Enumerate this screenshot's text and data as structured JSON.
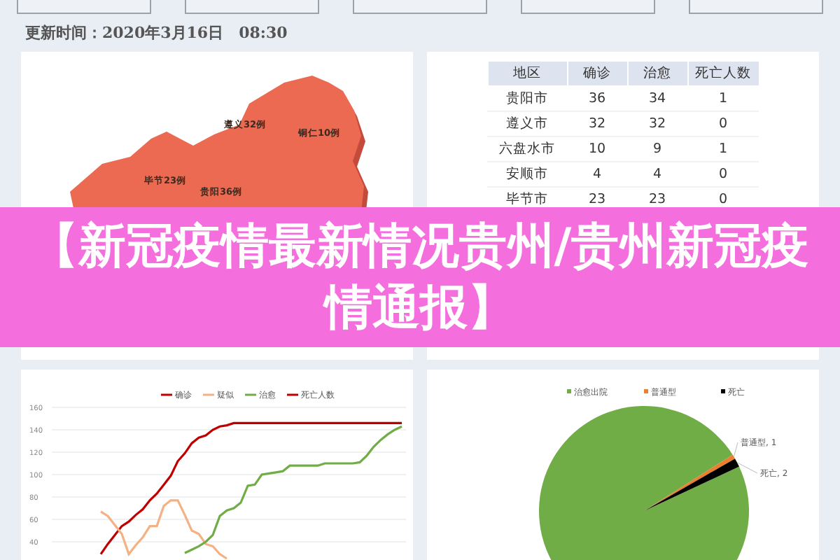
{
  "update_time": "更新时间：2020年3月16日　08:30",
  "map": {
    "labels": [
      "遵义32例",
      "铜仁10例",
      "毕节23例",
      "贵阳36例"
    ]
  },
  "table": {
    "columns": [
      "地区",
      "确诊",
      "治愈",
      "死亡人数"
    ],
    "rows": [
      {
        "cells": [
          "贵阳市",
          "36",
          "34",
          "1"
        ]
      },
      {
        "cells": [
          "遵义市",
          "32",
          "32",
          "0"
        ]
      },
      {
        "cells": [
          "六盘水市",
          "10",
          "9",
          "1"
        ]
      },
      {
        "cells": [
          "安顺市",
          "4",
          "4",
          "0"
        ]
      },
      {
        "cells": [
          "毕节市",
          "23",
          "23",
          "0"
        ]
      }
    ]
  },
  "line_chart": {
    "chart_data": {
      "type": "line",
      "ylim": [
        20,
        160
      ],
      "yticks": [
        40,
        60,
        80,
        100,
        120,
        140,
        160
      ],
      "grid": true,
      "legend": "top",
      "series": [
        {
          "name": "确诊",
          "color": "#c00000",
          "values": [
            29,
            38,
            46,
            54,
            58,
            64,
            69,
            77,
            83,
            91,
            99,
            112,
            119,
            128,
            133,
            135,
            140,
            143,
            144,
            146,
            146,
            146,
            146,
            146,
            146,
            146,
            146,
            146,
            146,
            146,
            146,
            146,
            146,
            146,
            146,
            146,
            146,
            146,
            146,
            146,
            146,
            146,
            146,
            146
          ]
        },
        {
          "name": "疑似",
          "color": "#f4b183",
          "values": [
            67,
            63,
            55,
            47,
            29,
            37,
            44,
            54,
            54,
            72,
            77,
            77,
            64,
            50,
            47,
            38,
            36,
            29,
            25,
            null,
            null,
            null,
            null,
            null,
            null,
            null,
            null,
            null,
            null,
            null,
            null,
            null,
            null,
            null,
            null,
            null,
            null,
            null,
            null,
            null,
            null,
            null,
            null,
            null
          ]
        },
        {
          "name": "治愈",
          "color": "#70ad47",
          "values": [
            null,
            null,
            null,
            null,
            null,
            null,
            null,
            null,
            null,
            null,
            null,
            null,
            30,
            33,
            36,
            40,
            46,
            63,
            68,
            70,
            75,
            90,
            91,
            100,
            101,
            102,
            103,
            108,
            108,
            108,
            108,
            108,
            110,
            110,
            110,
            110,
            110,
            111,
            117,
            125,
            131,
            136,
            140,
            143
          ]
        },
        {
          "name": "死亡人数",
          "color": "#c00000"
        }
      ]
    }
  },
  "pie_chart": {
    "chart_data": {
      "type": "pie",
      "legend": "top",
      "categories": [
        "治愈出院",
        "普通型",
        "死亡"
      ],
      "values": [
        143,
        1,
        2
      ],
      "colors": [
        "#70ad47",
        "#ed7d31",
        "#000000"
      ],
      "value_labels": [
        null,
        "普通型, 1",
        "死亡, 2"
      ]
    }
  },
  "banner": {
    "title": "【新冠疫情最新情况贵州/贵州新冠疫情通报】"
  }
}
